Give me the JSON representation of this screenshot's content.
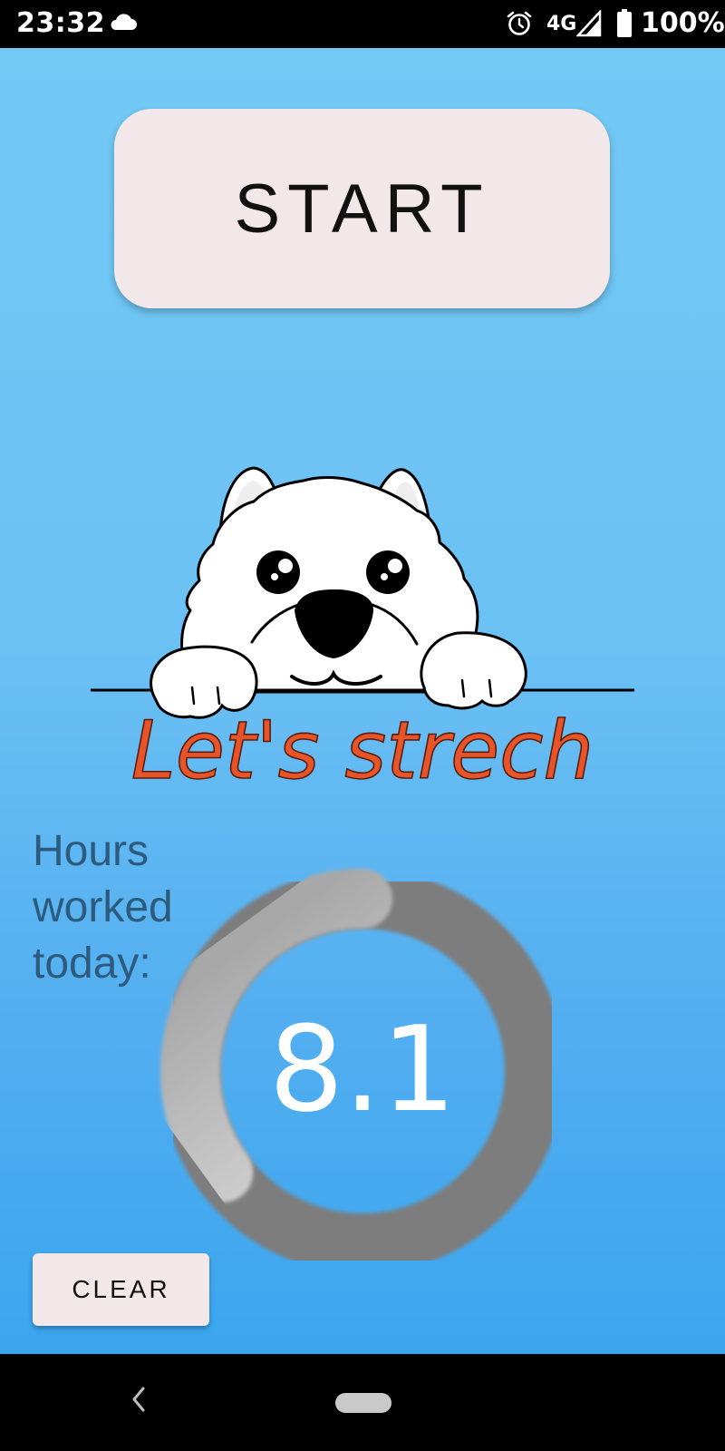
{
  "status_bar": {
    "time": "23:32",
    "network": "4G",
    "battery_percent": "100%",
    "icons": [
      "cloud-icon",
      "alarm-icon",
      "signal-icon",
      "battery-icon"
    ]
  },
  "main": {
    "start_label": "START",
    "slogan": "Let's strech",
    "hours_label": "Hours worked today:",
    "hours_value": "8.1",
    "hours_progress_fraction": 0.35,
    "clear_label": "CLEAR"
  },
  "nav_bar": {
    "icons": [
      "back-icon",
      "home-pill-icon"
    ]
  },
  "colors": {
    "background_top": "#72c9f4",
    "background_bottom": "#3aa6ef",
    "button_bg": "#f3e8e9",
    "slogan": "#e8542a",
    "hours_label": "#2c5b7d",
    "ring_track": "#7f7f7f",
    "ring_progress": "#d8d8d8"
  }
}
